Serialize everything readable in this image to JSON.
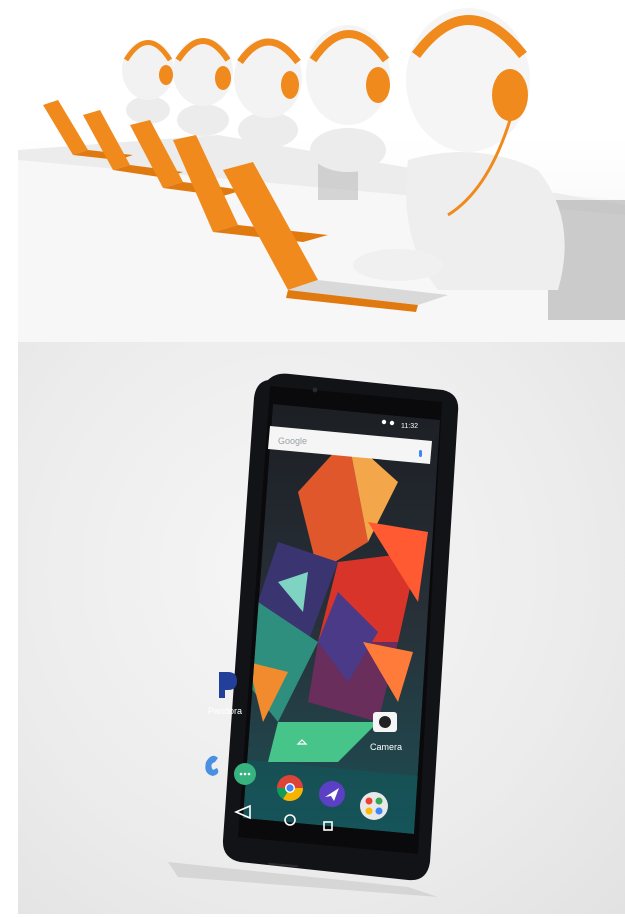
{
  "photos": {
    "top": {
      "icon": "call-center-figures-icon"
    },
    "bottom": {
      "icon": "smartphone-icon"
    }
  },
  "phone": {
    "status_time": "11:32",
    "search_logo": "Google",
    "apps": [
      {
        "label": "Pandora",
        "icon": "pandora-icon"
      },
      {
        "label": "Camera",
        "icon": "camera-icon"
      }
    ],
    "dock_icons": [
      "phone-icon",
      "messages-icon",
      "chrome-icon",
      "send-icon",
      "apps-folder-icon"
    ],
    "nav_icons": [
      "back-icon",
      "home-icon",
      "recents-icon"
    ]
  },
  "colors": {
    "orange": "#f08a1c",
    "figure": "#f4f4f4",
    "laptop_base": "#d9d9d9"
  }
}
